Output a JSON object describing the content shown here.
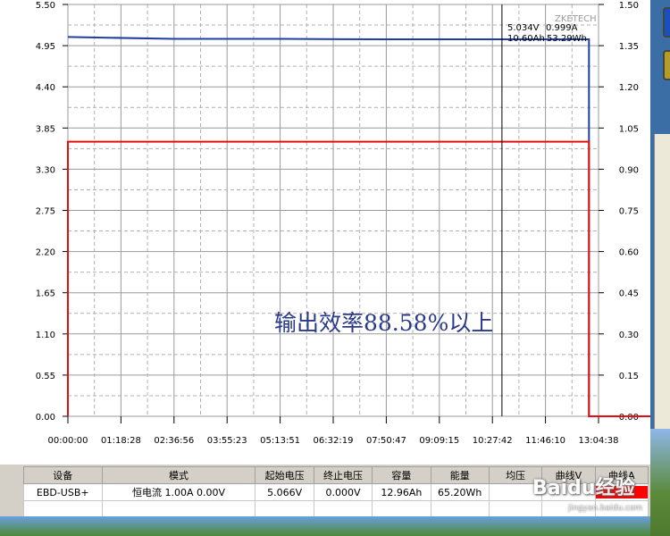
{
  "chart_data": {
    "type": "line",
    "brand": "ZKETECH",
    "annotation": "输出效率88.58%以上",
    "cursor_readout": {
      "voltage": "5.034V",
      "current": "0.999A",
      "capacity": "10.60Ah",
      "energy": "53.29Wh"
    },
    "x": [
      "00:00:00",
      "01:18:28",
      "02:36:56",
      "03:55:23",
      "05:13:51",
      "06:32:19",
      "07:50:47",
      "09:09:15",
      "10:27:42",
      "11:46:10",
      "13:04:38"
    ],
    "ylim_left": [
      0,
      5.5
    ],
    "yticks_left": [
      "5.50",
      "4.95",
      "4.40",
      "3.85",
      "3.30",
      "2.75",
      "2.20",
      "1.65",
      "1.10",
      "0.55",
      "0.00"
    ],
    "ylim_right": [
      0,
      1.5
    ],
    "yticks_right": [
      "1.50",
      "1.35",
      "1.20",
      "1.05",
      "0.90",
      "0.75",
      "0.60",
      "0.45",
      "0.30",
      "0.15",
      "0.00"
    ],
    "series": [
      {
        "name": "曲线V",
        "color": "#1f3fa0",
        "axis": "left",
        "points": [
          [
            0,
            5.066
          ],
          [
            2,
            5.04
          ],
          [
            4,
            5.04
          ],
          [
            6,
            5.034
          ],
          [
            8,
            5.034
          ],
          [
            9.82,
            5.034
          ],
          [
            9.82,
            0
          ],
          [
            10,
            0
          ]
        ]
      },
      {
        "name": "曲线A",
        "color": "#e01010",
        "axis": "right",
        "points": [
          [
            0,
            0
          ],
          [
            0,
            1.0
          ],
          [
            2,
            1.0
          ],
          [
            4,
            1.0
          ],
          [
            6,
            1.0
          ],
          [
            8,
            1.0
          ],
          [
            9.82,
            1.0
          ],
          [
            9.82,
            0
          ],
          [
            10,
            0
          ]
        ]
      }
    ],
    "grid": true,
    "cursor_x": 8.18
  },
  "table": {
    "headers": [
      "设备",
      "模式",
      "起始电压",
      "终止电压",
      "容量",
      "能量",
      "均压",
      "曲线V",
      "曲线A"
    ],
    "row": {
      "device": "EBD-USB+",
      "mode": "恒电流  1.00A  0.00V",
      "start_voltage": "5.066V",
      "end_voltage": "0.000V",
      "capacity": "12.96Ah",
      "energy": "65.20Wh",
      "avg_voltage": "",
      "curve_v_color": "#ffffff",
      "curve_a_color": "#ff0000"
    }
  },
  "watermark": {
    "text": "Baidu经验",
    "sub": "jingyan.baidu.com"
  }
}
